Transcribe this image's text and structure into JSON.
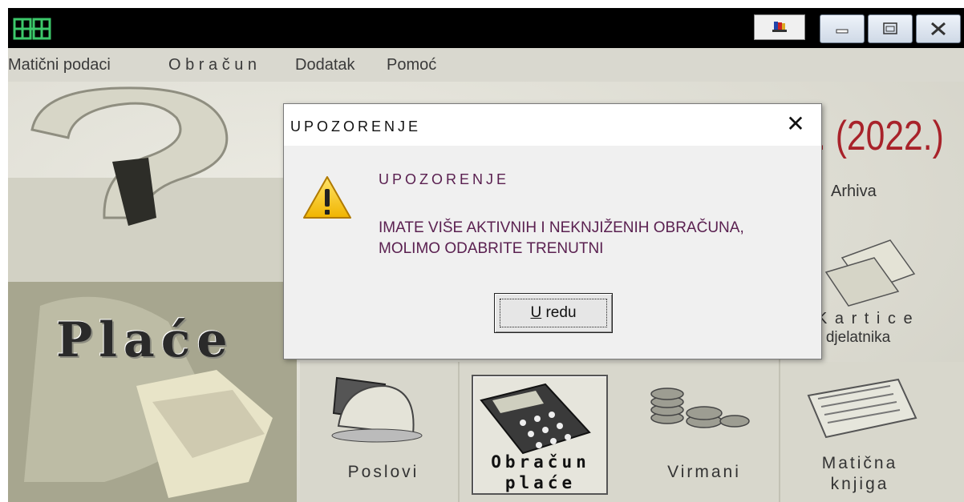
{
  "window": {
    "menu": [
      "Matični podaci",
      "O b r a č u n",
      "Dodatak",
      "Pomoć"
    ]
  },
  "background": {
    "logo_text": "Plaće",
    "year_title": ". (2022.)",
    "arhiva": "Arhiva",
    "tiles": {
      "kartice": [
        "K a r t i c e",
        "djelatnika"
      ],
      "poslovi": "Poslovi",
      "obracun": [
        "Obračun",
        "plaće"
      ],
      "virmani": "Virmani",
      "maticna": [
        "Matična",
        "knjiga"
      ]
    }
  },
  "dialog": {
    "title": "UPOZORENJE",
    "heading": "UPOZORENJE",
    "message_lines": [
      "IMATE VIŠE AKTIVNIH I NEKNJIŽENIH OBRAČUNA,",
      "MOLIMO ODABRITE TRENUTNI"
    ],
    "ok_button": {
      "mnemonic": "U",
      "rest": " redu"
    },
    "close_glyph": "✕"
  },
  "colors": {
    "year_title": "#a8222a",
    "message_text": "#5a2050",
    "titlebar": "#000000",
    "menubar": "#d9d8cf"
  },
  "icons": [
    "app-logo-icon",
    "system-icon",
    "minimize-icon",
    "maximize-icon",
    "close-icon",
    "warning-icon",
    "hard-hat-icon",
    "calculator-icon",
    "coins-icon",
    "newspaper-icon",
    "money-icon"
  ]
}
